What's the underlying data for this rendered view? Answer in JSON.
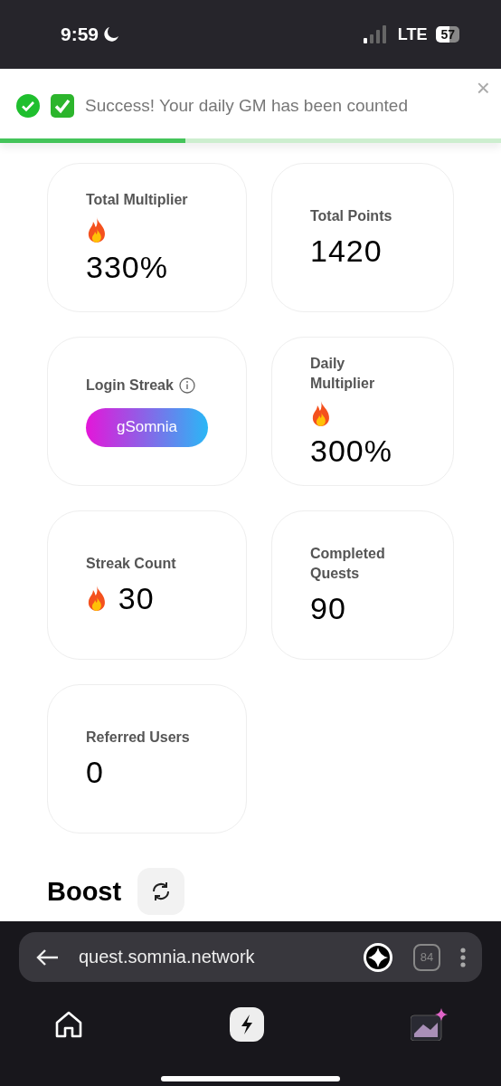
{
  "status_bar": {
    "time": "9:59",
    "carrier": "LTE",
    "battery": "57"
  },
  "toast": {
    "message": "Success! Your daily GM has been counted",
    "close": "×",
    "level": 0.37
  },
  "cards": [
    {
      "kind": "flame_stat",
      "label": "Total Multiplier",
      "value": "330%"
    },
    {
      "kind": "stat",
      "label": "Total Points",
      "value": "1420"
    },
    {
      "kind": "badge",
      "label": "Login Streak",
      "info": true,
      "badge": "gSomnia"
    },
    {
      "kind": "flame_stat",
      "label": "Daily Multiplier",
      "value": "300%"
    },
    {
      "kind": "inline_flame",
      "label": "Streak Count",
      "value": "30"
    },
    {
      "kind": "stat",
      "label": "Completed Quests",
      "value": "90"
    },
    {
      "kind": "stat",
      "label": "Referred Users",
      "value": "0"
    }
  ],
  "section": {
    "title": "Boost"
  },
  "browser": {
    "url": "quest.somnia.network",
    "tab_count": "84"
  }
}
